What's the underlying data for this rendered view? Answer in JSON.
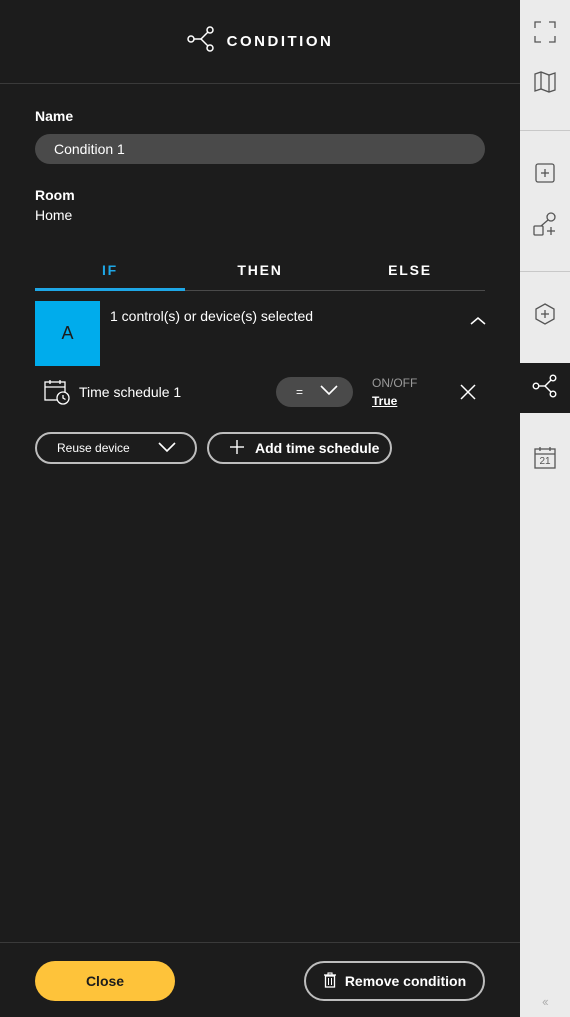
{
  "header": {
    "title": "CONDITION",
    "icon": "condition-share-icon"
  },
  "form": {
    "name_label": "Name",
    "name_value": "Condition 1",
    "room_label": "Room",
    "room_value": "Home"
  },
  "tabs": [
    {
      "label": "IF",
      "active": true
    },
    {
      "label": "THEN",
      "active": false
    },
    {
      "label": "ELSE",
      "active": false
    }
  ],
  "device": {
    "tile_letter": "A",
    "tile_color": "#00acec",
    "summary": "1 control(s) or device(s) selected"
  },
  "schedule_row": {
    "icon": "calendar-clock-icon",
    "name": "Time schedule 1",
    "operator": "=",
    "onoff_label": "ON/OFF",
    "onoff_value": "True"
  },
  "actions": {
    "reuse_label": "Reuse device",
    "add_label": "Add time schedule"
  },
  "footer": {
    "close_label": "Close",
    "remove_label": "Remove condition"
  },
  "sidebar": {
    "items": [
      {
        "icon": "fullscreen-icon"
      },
      {
        "icon": "map-icon"
      },
      {
        "icon": "add-square-icon"
      },
      {
        "icon": "add-shapes-icon"
      },
      {
        "icon": "add-hexagon-icon"
      },
      {
        "icon": "condition-share-icon",
        "active": true
      },
      {
        "icon": "calendar-icon",
        "calendar_day": "21"
      }
    ],
    "collapse_glyph": "‹‹"
  },
  "colors": {
    "accent": "#1ea7e6",
    "primary_button": "#fec33a",
    "background": "#1c1c1c",
    "sidebar": "#ebebeb"
  }
}
